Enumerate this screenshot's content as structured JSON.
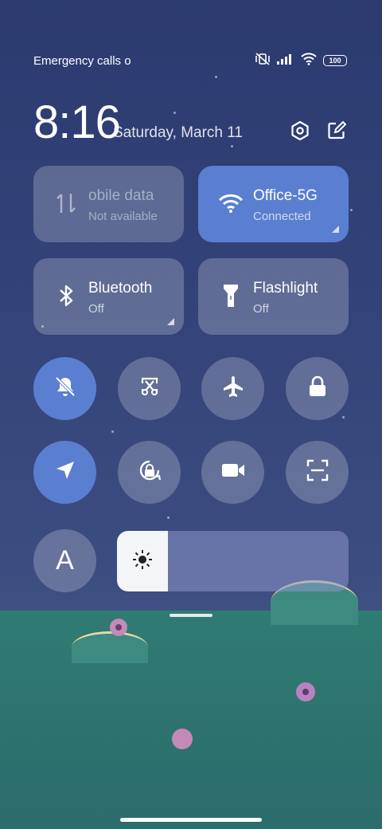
{
  "status_bar": {
    "carrier_text": "Emergency calls o",
    "battery": "100",
    "icons": [
      "vibrate-off-icon",
      "signal-icon",
      "wifi-icon",
      "battery-icon"
    ]
  },
  "header": {
    "time": "8:16",
    "date": "Saturday, March 11",
    "icons": [
      "settings-icon",
      "edit-icon"
    ]
  },
  "tiles": [
    {
      "title": "obile data",
      "subtitle": "Not available",
      "icon": "mobile-data-icon",
      "active": false
    },
    {
      "title": "Office-5G",
      "subtitle": "Connected",
      "icon": "wifi-icon",
      "active": true
    },
    {
      "title": "Bluetooth",
      "subtitle": "Off",
      "icon": "bluetooth-icon",
      "active": false
    },
    {
      "title": "Flashlight",
      "subtitle": "Off",
      "icon": "flashlight-icon",
      "active": false
    }
  ],
  "toggles_row1": [
    {
      "icon": "mute-bell-icon",
      "active": true
    },
    {
      "icon": "screenshot-icon",
      "active": false
    },
    {
      "icon": "airplane-icon",
      "active": false
    },
    {
      "icon": "lock-icon",
      "active": false
    }
  ],
  "toggles_row2": [
    {
      "icon": "location-icon",
      "active": true
    },
    {
      "icon": "rotation-lock-icon",
      "active": false
    },
    {
      "icon": "video-camera-icon",
      "active": false
    },
    {
      "icon": "scan-icon",
      "active": false
    }
  ],
  "font_button": {
    "label": "A"
  },
  "brightness": {
    "level": 0.22,
    "icon": "sun-icon"
  },
  "colors": {
    "accent": "#5a7fd0",
    "tile": "rgba(255,255,255,0.22)",
    "sky": "#2f3e74",
    "grass": "#2e7470"
  }
}
